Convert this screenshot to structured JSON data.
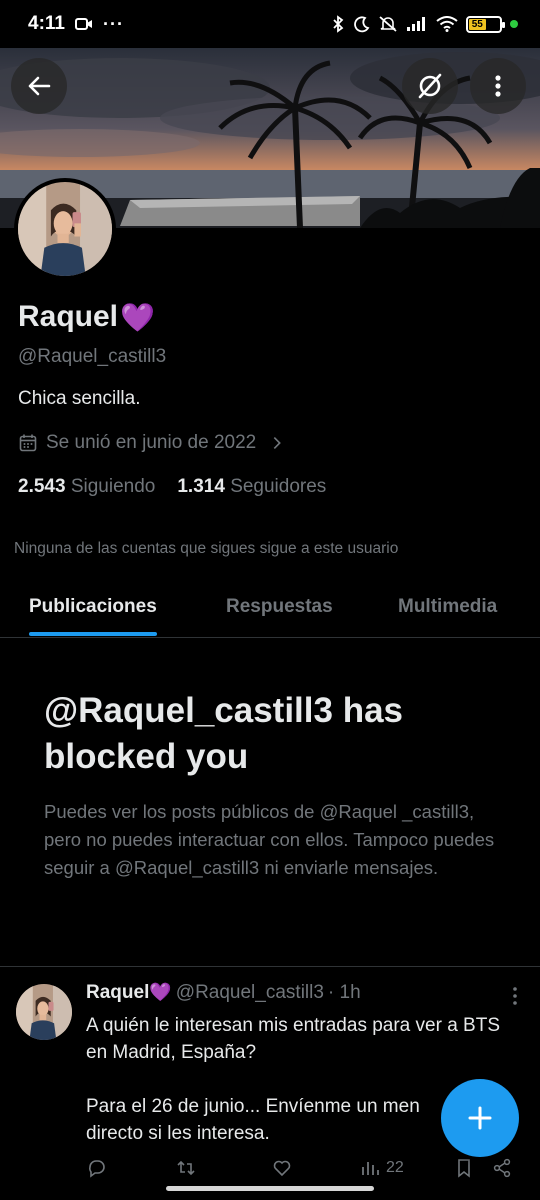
{
  "status_bar": {
    "time": "4:11",
    "battery": "55",
    "signal_icons": [
      "bluetooth-icon",
      "moon-icon",
      "mute-icon",
      "signal-icon",
      "wifi-icon"
    ]
  },
  "nav": {
    "back_icon": "back-arrow-icon",
    "grok_icon": "grok-icon",
    "more_icon": "more-vertical-icon"
  },
  "profile": {
    "display_name": "Raquel",
    "heart": "💜",
    "handle": "@Raquel_castill3",
    "bio": "Chica sencilla.",
    "joined": "Se unió en junio de 2022",
    "following_count": "2.543",
    "following_label": "Siguiendo",
    "followers_count": "1.314",
    "followers_label": "Seguidores",
    "followers_note": "Ninguna de las cuentas que sigues sigue a este usuario"
  },
  "tabs": [
    {
      "label": "Publicaciones",
      "active": true
    },
    {
      "label": "Respuestas",
      "active": false
    },
    {
      "label": "Multimedia",
      "active": false
    }
  ],
  "blocked": {
    "title": "@Raquel_castill3 has blocked you",
    "body": "Puedes ver los posts públicos de @Raquel _castill3, pero no puedes interactuar con ellos. Tampoco puedes seguir a @Raquel_castill3 ni enviarle mensajes."
  },
  "tweet": {
    "name": "Raquel",
    "heart": "💜",
    "handle": "@Raquel_castill3",
    "time": "· 1h",
    "text": "A quién le interesan mis entradas para ver a BTS en Madrid, España?\n\nPara el 26 de junio... Envíenme un men\ndirecto si les interesa.",
    "views": "22"
  },
  "colors": {
    "accent": "#1d9bf0",
    "muted": "#71767b",
    "text": "#e7e9ea",
    "background": "#000000"
  }
}
